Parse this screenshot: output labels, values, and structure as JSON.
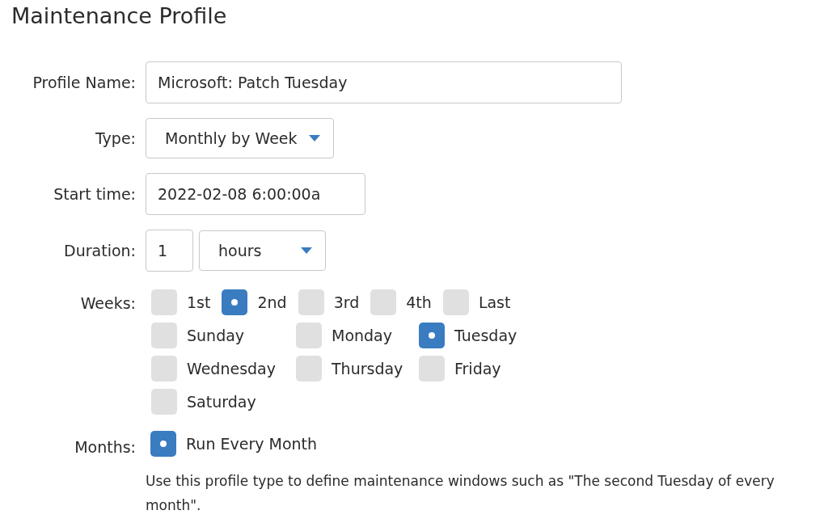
{
  "title": "Maintenance Profile",
  "profile_name": {
    "label": "Profile Name:",
    "value": "Microsoft: Patch Tuesday"
  },
  "type": {
    "label": "Type:",
    "value": "Monthly by Week"
  },
  "start_time": {
    "label": "Start time:",
    "value": "2022-02-08 6:00:00a"
  },
  "duration": {
    "label": "Duration:",
    "value": "1",
    "unit": "hours"
  },
  "weeks": {
    "label": "Weeks:",
    "ordinals": [
      {
        "label": "1st",
        "checked": false
      },
      {
        "label": "2nd",
        "checked": true
      },
      {
        "label": "3rd",
        "checked": false
      },
      {
        "label": "4th",
        "checked": false
      },
      {
        "label": "Last",
        "checked": false
      }
    ],
    "days": [
      {
        "label": "Sunday",
        "checked": false
      },
      {
        "label": "Monday",
        "checked": false
      },
      {
        "label": "Tuesday",
        "checked": true
      },
      {
        "label": "Wednesday",
        "checked": false
      },
      {
        "label": "Thursday",
        "checked": false
      },
      {
        "label": "Friday",
        "checked": false
      },
      {
        "label": "Saturday",
        "checked": false
      }
    ]
  },
  "months": {
    "label": "Months:",
    "option": {
      "label": "Run Every Month",
      "checked": true
    }
  },
  "help_text": "Use this profile type to define maintenance windows such as \"The second Tuesday of every month\"."
}
